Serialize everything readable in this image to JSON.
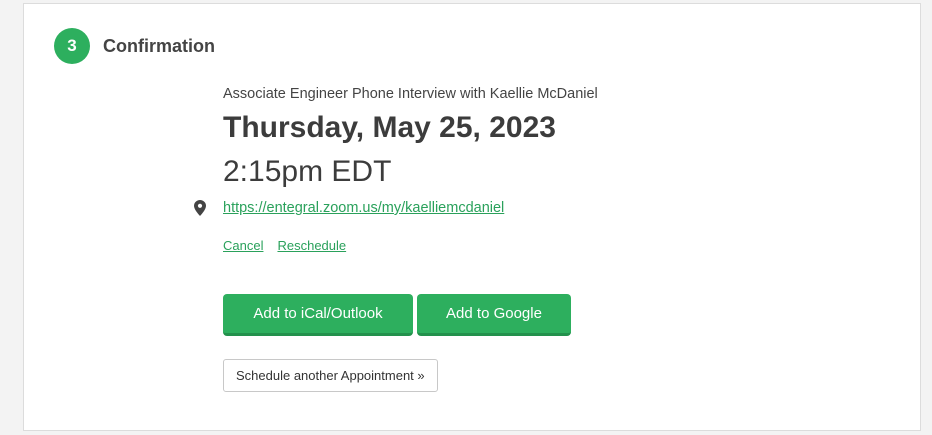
{
  "step": {
    "number": "3",
    "title": "Confirmation"
  },
  "appointment": {
    "name": "Associate Engineer Phone Interview with Kaellie McDaniel",
    "date": "Thursday, May 25, 2023",
    "time": "2:15pm EDT",
    "location_icon": "map-pin-icon",
    "location_url": "https://entegral.zoom.us/my/kaelliemcdaniel"
  },
  "actions": {
    "cancel_label": "Cancel",
    "reschedule_label": "Reschedule"
  },
  "calendar": {
    "ical_label": "Add to iCal/Outlook",
    "google_label": "Add to Google"
  },
  "schedule_another_label": "Schedule another Appointment »",
  "colors": {
    "accent": "#2daf5e",
    "link": "#2aa15b",
    "text": "#333333"
  }
}
